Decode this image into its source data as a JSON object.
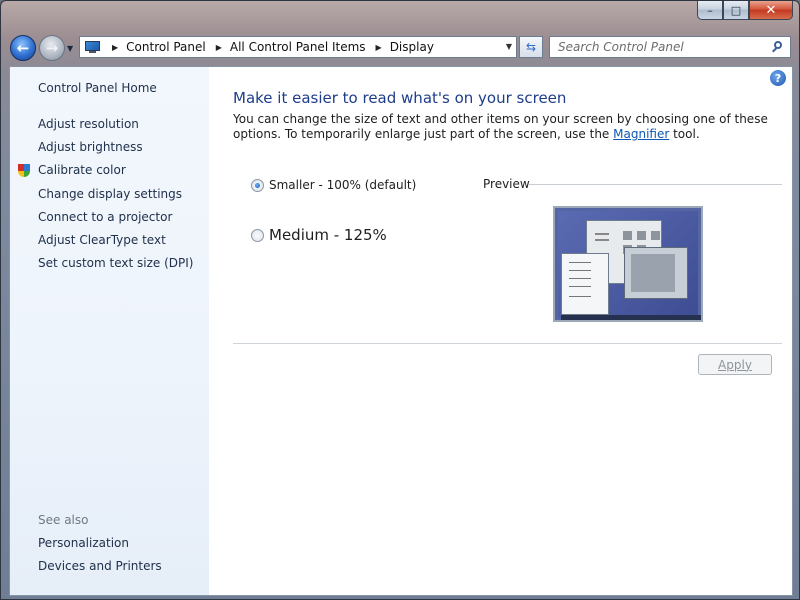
{
  "window": {
    "caption_buttons": {
      "minimize": "–",
      "maximize": "□",
      "close": "✕"
    }
  },
  "nav": {
    "back_glyph": "←",
    "forward_glyph": "→",
    "dropdown_glyph": "▼",
    "refresh_glyph": "⇆"
  },
  "address_bar": {
    "icon": "display-monitor-icon",
    "breadcrumbs": [
      "Control Panel",
      "All Control Panel Items",
      "Display"
    ],
    "separator": "▶"
  },
  "search": {
    "placeholder": "Search Control Panel",
    "value": ""
  },
  "sidebar": {
    "home": "Control Panel Home",
    "items": [
      "Adjust resolution",
      "Adjust brightness",
      "Calibrate color",
      "Change display settings",
      "Connect to a projector",
      "Adjust ClearType text",
      "Set custom text size (DPI)"
    ],
    "calibrate_icon": "uac-shield-icon",
    "see_also_label": "See also",
    "see_also": [
      "Personalization",
      "Devices and Printers"
    ]
  },
  "main": {
    "help_glyph": "?",
    "heading": "Make it easier to read what's on your screen",
    "description_before": "You can change the size of text and other items on your screen by choosing one of these options. To temporarily enlarge just part of the screen, use the ",
    "magnifier_link": "Magnifier",
    "description_after": " tool.",
    "options": [
      {
        "label": "Smaller - 100% (default)",
        "checked": true
      },
      {
        "label": "Medium - 125%",
        "checked": false
      }
    ],
    "preview_label": "Preview",
    "apply_label": "Apply",
    "apply_enabled": false
  }
}
